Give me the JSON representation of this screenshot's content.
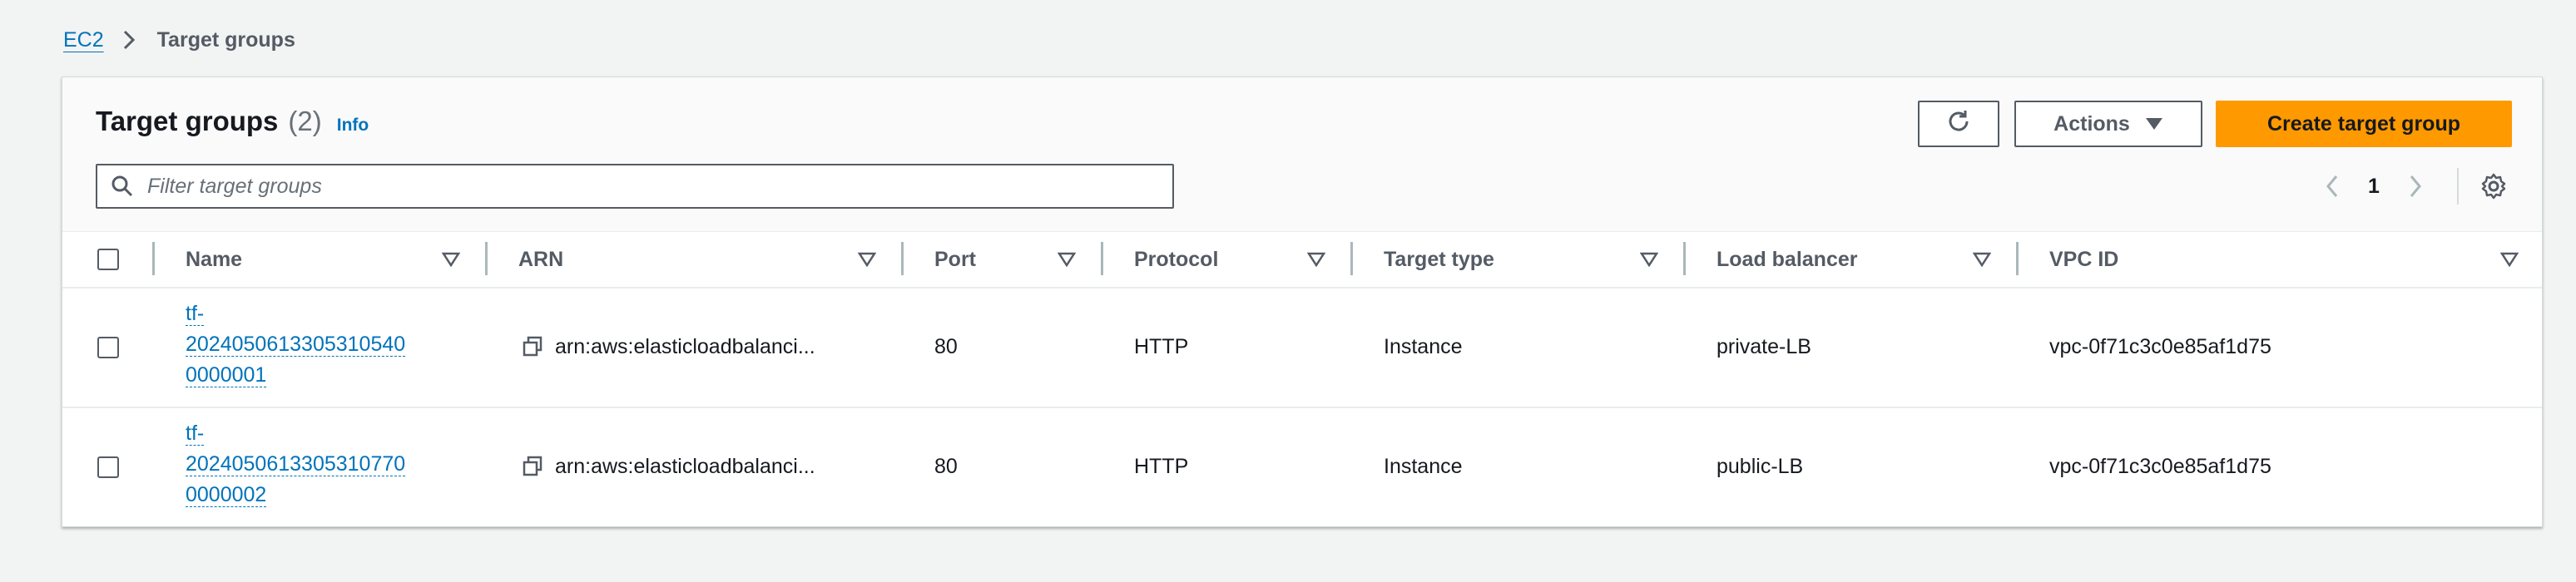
{
  "breadcrumb": {
    "root": "EC2",
    "current": "Target groups"
  },
  "header": {
    "title": "Target groups",
    "count": "(2)",
    "info": "Info"
  },
  "buttons": {
    "refresh_icon": "refresh-icon",
    "actions": "Actions",
    "create": "Create target group"
  },
  "filter": {
    "placeholder": "Filter target groups",
    "value": ""
  },
  "pagination": {
    "page": "1"
  },
  "columns": [
    "Name",
    "ARN",
    "Port",
    "Protocol",
    "Target type",
    "Load balancer",
    "VPC ID"
  ],
  "rows": [
    {
      "name_lines": [
        "tf-",
        "2024050613305310540",
        "0000001"
      ],
      "arn": "arn:aws:elasticloadbalanci...",
      "port": "80",
      "protocol": "HTTP",
      "target_type": "Instance",
      "load_balancer": "private-LB",
      "vpc_id": "vpc-0f71c3c0e85af1d75"
    },
    {
      "name_lines": [
        "tf-",
        "2024050613305310770",
        "0000002"
      ],
      "arn": "arn:aws:elasticloadbalanci...",
      "port": "80",
      "protocol": "HTTP",
      "target_type": "Instance",
      "load_balancer": "public-LB",
      "vpc_id": "vpc-0f71c3c0e85af1d75"
    }
  ],
  "colors": {
    "link": "#0073bb",
    "primary_button": "#ff9900",
    "background": "#f2f3f3"
  }
}
